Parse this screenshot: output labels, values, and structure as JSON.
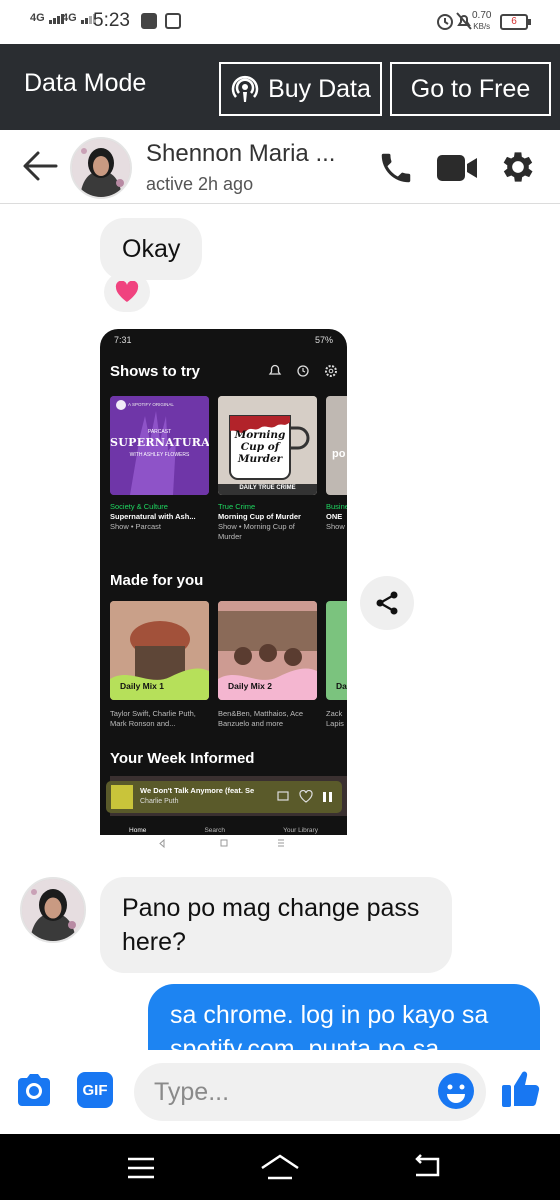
{
  "status_bar": {
    "sim1": "4G",
    "sim2": "4G",
    "time": "5:23",
    "net_speed_value": "0.70",
    "net_speed_unit": "KB/s",
    "battery": "6"
  },
  "data_mode": {
    "title": "Data Mode",
    "buy_data_label": "Buy Data",
    "go_free_label": "Go to Free"
  },
  "header": {
    "contact_name": "Shennon Maria ...",
    "contact_status": "active 2h ago"
  },
  "messages": {
    "m1": "Okay",
    "m1_reaction": "heart",
    "m3": "Pano po mag change pass here?",
    "m4": "sa chrome. log in po kayo sa spotify.com. punta po sa"
  },
  "shared_screenshot": {
    "time": "7:31",
    "battery": "57%",
    "section1": "Shows to try",
    "tiles1": [
      {
        "art_title": "SUPERNATURAL",
        "art_sub": "WITH ASHLEY FLOWERS",
        "art_top": "PARCAST",
        "badge": "A SPOTIFY ORIGINAL",
        "category": "Society & Culture",
        "name": "Supernatural with Ash...",
        "sub": "Show • Parcast"
      },
      {
        "art_title": "Morning Cup of Murder",
        "art_sub": "DAILY TRUE CRIME",
        "category": "True Crime",
        "name": "Morning Cup of Murder",
        "sub": "Show • Morning Cup of Murder"
      },
      {
        "category": "Busine",
        "name": "ONE",
        "sub": "Show",
        "art_title": "po"
      }
    ],
    "section2": "Made for you",
    "tiles2": [
      {
        "art_title": "Daily Mix 1",
        "sub": "Taylor Swift, Charlie Puth, Mark Ronson and..."
      },
      {
        "art_title": "Daily Mix 2",
        "sub": "Ben&Ben, Matthaios, Ace Banzuelo and more"
      },
      {
        "art_title": "Da",
        "sub": "Zack Lapis"
      }
    ],
    "section3": "Your Week Informed",
    "now_playing_title": "We Don't Talk Anymore (feat. Se",
    "now_playing_artist": "Charlie Puth",
    "nav": [
      "Home",
      "Search",
      "Your Library"
    ]
  },
  "composer": {
    "placeholder": "Type...",
    "gif_label": "GIF"
  },
  "colors": {
    "messenger_blue": "#1d84f2",
    "data_bar": "#2a2d31",
    "bubble_gray": "#f0f0f0"
  }
}
